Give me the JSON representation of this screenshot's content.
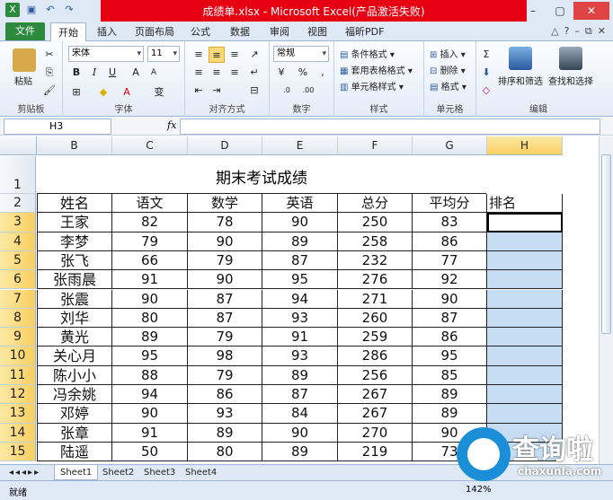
{
  "window": {
    "title": "成绩单.xlsx - Microsoft Excel(产品激活失败)"
  },
  "tabs": {
    "file": "文件",
    "items": [
      "开始",
      "插入",
      "页面布局",
      "公式",
      "数据",
      "审阅",
      "视图",
      "福昕PDF"
    ]
  },
  "ribbon": {
    "clipboard": {
      "label": "剪贴板",
      "paste": "粘贴"
    },
    "font": {
      "label": "字体",
      "family": "宋体",
      "size": "11"
    },
    "alignment": {
      "label": "对齐方式"
    },
    "number": {
      "label": "数字",
      "format": "常规"
    },
    "styles": {
      "label": "样式",
      "conditional": "条件格式",
      "table": "套用表格格式",
      "cell": "单元格样式"
    },
    "cells": {
      "label": "单元格",
      "insert": "插入",
      "delete": "删除",
      "format": "格式"
    },
    "editing": {
      "label": "编辑",
      "sort": "排序和筛选",
      "find": "查找和选择"
    }
  },
  "formula_bar": {
    "name_box": "H3",
    "fx": "fx",
    "value": ""
  },
  "grid": {
    "columns": [
      "B",
      "C",
      "D",
      "E",
      "F",
      "G",
      "H"
    ],
    "selected_column": "H",
    "row_numbers": [
      "1",
      "2",
      "3",
      "4",
      "5",
      "6",
      "7",
      "8",
      "9",
      "10",
      "11",
      "12",
      "13",
      "14",
      "15"
    ],
    "title": "期末考试成绩",
    "headers": [
      "姓名",
      "语文",
      "数学",
      "英语",
      "总分",
      "平均分",
      "排名"
    ],
    "rows": [
      [
        "王家",
        "82",
        "78",
        "90",
        "250",
        "83",
        ""
      ],
      [
        "李梦",
        "79",
        "90",
        "89",
        "258",
        "86",
        ""
      ],
      [
        "张飞",
        "66",
        "79",
        "87",
        "232",
        "77",
        ""
      ],
      [
        "张雨晨",
        "91",
        "90",
        "95",
        "276",
        "92",
        ""
      ],
      [
        "张震",
        "90",
        "87",
        "94",
        "271",
        "90",
        ""
      ],
      [
        "刘华",
        "80",
        "87",
        "93",
        "260",
        "87",
        ""
      ],
      [
        "黄光",
        "89",
        "79",
        "91",
        "259",
        "86",
        ""
      ],
      [
        "关心月",
        "95",
        "98",
        "93",
        "286",
        "95",
        ""
      ],
      [
        "陈小小",
        "88",
        "79",
        "89",
        "256",
        "85",
        ""
      ],
      [
        "冯余姚",
        "94",
        "86",
        "87",
        "267",
        "89",
        ""
      ],
      [
        "邓婷",
        "90",
        "93",
        "84",
        "267",
        "89",
        ""
      ],
      [
        "张章",
        "91",
        "89",
        "90",
        "270",
        "90",
        ""
      ],
      [
        "陆遥",
        "50",
        "80",
        "89",
        "219",
        "73",
        ""
      ]
    ]
  },
  "sheets": [
    "Sheet1",
    "Sheet2",
    "Sheet3",
    "Sheet4"
  ],
  "status": {
    "ready": "就绪",
    "zoom": "142%"
  },
  "watermark": {
    "text": "查询啦",
    "sub": "chaxunla.com"
  }
}
